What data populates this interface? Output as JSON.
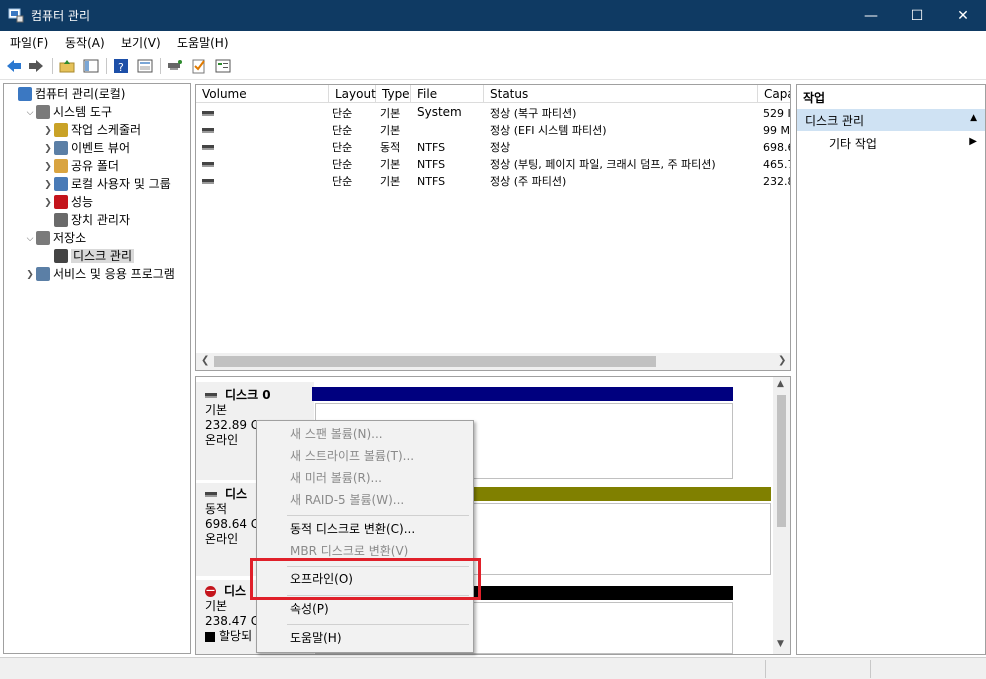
{
  "window": {
    "title": "컴퓨터 관리"
  },
  "menubar": [
    {
      "label": "파일(F)"
    },
    {
      "label": "동작(A)"
    },
    {
      "label": "보기(V)"
    },
    {
      "label": "도움말(H)"
    }
  ],
  "toolbar": {
    "icons": [
      "back-icon",
      "forward-icon",
      "up-folder-icon",
      "show-hide-tree-icon",
      "help-icon",
      "properties-icon",
      "connect-icon",
      "check-icon",
      "view-icon"
    ]
  },
  "tree": {
    "items": [
      {
        "label": "컴퓨터 관리(로컬)",
        "icon": "computer-management-icon",
        "level": 0,
        "expand": ""
      },
      {
        "label": "시스템 도구",
        "icon": "system-tools-icon",
        "level": 1,
        "expand": "v"
      },
      {
        "label": "작업 스케줄러",
        "icon": "clock-icon",
        "level": 2,
        "expand": ">"
      },
      {
        "label": "이벤트 뷰어",
        "icon": "event-viewer-icon",
        "level": 2,
        "expand": ">"
      },
      {
        "label": "공유 폴더",
        "icon": "shared-folder-icon",
        "level": 2,
        "expand": ">"
      },
      {
        "label": "로컬 사용자 및 그룹",
        "icon": "users-icon",
        "level": 2,
        "expand": ">"
      },
      {
        "label": "성능",
        "icon": "performance-icon",
        "level": 2,
        "expand": ">"
      },
      {
        "label": "장치 관리자",
        "icon": "device-manager-icon",
        "level": 2,
        "expand": ""
      },
      {
        "label": "저장소",
        "icon": "storage-icon",
        "level": 1,
        "expand": "v"
      },
      {
        "label": "디스크 관리",
        "icon": "disk-management-icon",
        "level": 2,
        "expand": "",
        "selected": true
      },
      {
        "label": "서비스 및 응용 프로그램",
        "icon": "services-icon",
        "level": 1,
        "expand": ">"
      }
    ]
  },
  "volumes": {
    "columns": [
      "Volume",
      "Layout",
      "Type",
      "File System",
      "Status",
      "Capa"
    ],
    "rows": [
      {
        "volume": "",
        "layout": "단순",
        "type": "기본",
        "fs": "",
        "status": "정상 (복구 파티션)",
        "capacity": "529 I"
      },
      {
        "volume": "",
        "layout": "단순",
        "type": "기본",
        "fs": "",
        "status": "정상 (EFI 시스템 파티션)",
        "capacity": "99 M"
      },
      {
        "volume": "",
        "layout": "단순",
        "type": "동적",
        "fs": "NTFS",
        "status": "정상",
        "capacity": "698.6"
      },
      {
        "volume": "",
        "layout": "단순",
        "type": "기본",
        "fs": "NTFS",
        "status": "정상 (부팅, 페이지 파일, 크래시 덤프, 주 파티션)",
        "capacity": "465.7"
      },
      {
        "volume": "",
        "layout": "단순",
        "type": "기본",
        "fs": "NTFS",
        "status": "정상 (주 파티션)",
        "capacity": "232.8"
      }
    ]
  },
  "disks": [
    {
      "name": "디스크 0",
      "type": "기본",
      "size": "232.89 G",
      "state": "온라인",
      "bar_color": "#00007f"
    },
    {
      "name": "디스",
      "type": "동적",
      "size": "698.64 G",
      "state": "온라인",
      "bar_color": "#808000"
    },
    {
      "name": "디스",
      "type": "기본",
      "size": "238.47 G",
      "state": "할당되",
      "bar_color": "#000000"
    }
  ],
  "actions": {
    "header": "작업",
    "section": "디스크 관리",
    "items": [
      {
        "label": "기타 작업"
      }
    ]
  },
  "context_menu": {
    "items": [
      {
        "label": "새 스팬 볼륨(N)...",
        "disabled": true
      },
      {
        "label": "새 스트라이프 볼륨(T)...",
        "disabled": true
      },
      {
        "label": "새 미러 볼륨(R)...",
        "disabled": true
      },
      {
        "label": "새 RAID-5 볼륨(W)...",
        "disabled": true
      },
      {
        "label": "동적 디스크로 변환(C)...",
        "disabled": false
      },
      {
        "label": "MBR 디스크로 변환(V)",
        "disabled": true
      },
      {
        "label": "오프라인(O)",
        "disabled": false,
        "highlighted": true
      },
      {
        "label": "속성(P)",
        "disabled": false
      },
      {
        "label": "도움말(H)",
        "disabled": false
      }
    ]
  },
  "colors": {
    "titlebar": "#0f3a63",
    "highlight_box": "#e0202a",
    "selection": "#cfe2f3"
  }
}
